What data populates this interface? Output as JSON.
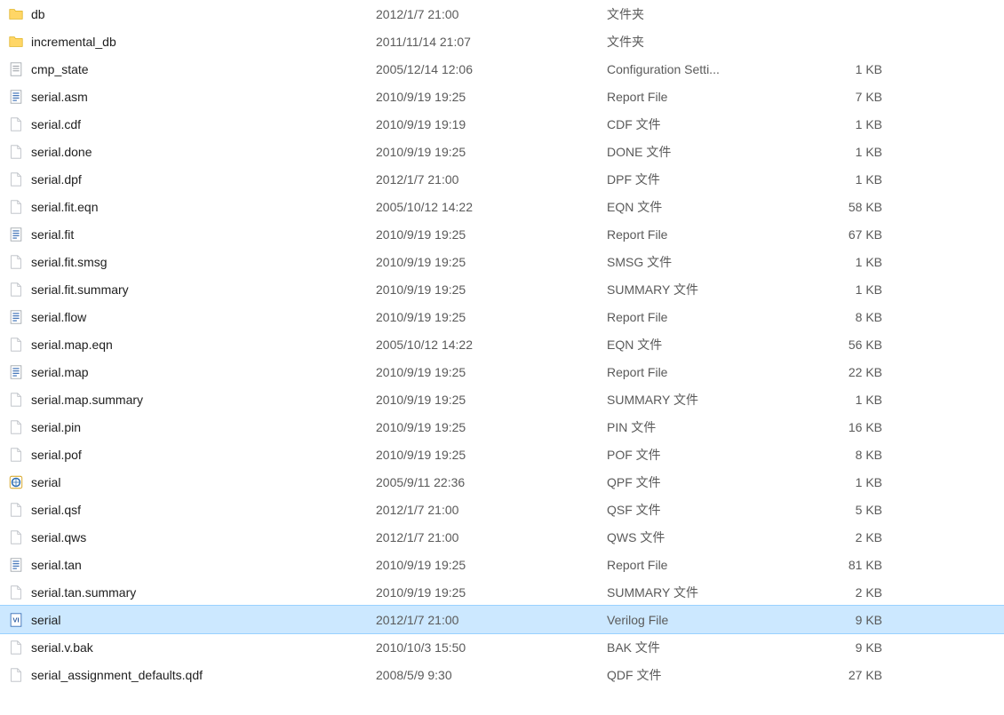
{
  "files": [
    {
      "icon": "folder",
      "name": "db",
      "date": "2012/1/7 21:00",
      "type": "文件夹",
      "size": "",
      "selected": false
    },
    {
      "icon": "folder",
      "name": "incremental_db",
      "date": "2011/11/14 21:07",
      "type": "文件夹",
      "size": "",
      "selected": false
    },
    {
      "icon": "text-lines",
      "name": "cmp_state",
      "date": "2005/12/14 12:06",
      "type": "Configuration Setti...",
      "size": "1 KB",
      "selected": false
    },
    {
      "icon": "report",
      "name": "serial.asm",
      "date": "2010/9/19 19:25",
      "type": "Report File",
      "size": "7 KB",
      "selected": false
    },
    {
      "icon": "blank",
      "name": "serial.cdf",
      "date": "2010/9/19 19:19",
      "type": "CDF 文件",
      "size": "1 KB",
      "selected": false
    },
    {
      "icon": "blank",
      "name": "serial.done",
      "date": "2010/9/19 19:25",
      "type": "DONE 文件",
      "size": "1 KB",
      "selected": false
    },
    {
      "icon": "blank",
      "name": "serial.dpf",
      "date": "2012/1/7 21:00",
      "type": "DPF 文件",
      "size": "1 KB",
      "selected": false
    },
    {
      "icon": "blank",
      "name": "serial.fit.eqn",
      "date": "2005/10/12 14:22",
      "type": "EQN 文件",
      "size": "58 KB",
      "selected": false
    },
    {
      "icon": "report",
      "name": "serial.fit",
      "date": "2010/9/19 19:25",
      "type": "Report File",
      "size": "67 KB",
      "selected": false
    },
    {
      "icon": "blank",
      "name": "serial.fit.smsg",
      "date": "2010/9/19 19:25",
      "type": "SMSG 文件",
      "size": "1 KB",
      "selected": false
    },
    {
      "icon": "blank",
      "name": "serial.fit.summary",
      "date": "2010/9/19 19:25",
      "type": "SUMMARY 文件",
      "size": "1 KB",
      "selected": false
    },
    {
      "icon": "report",
      "name": "serial.flow",
      "date": "2010/9/19 19:25",
      "type": "Report File",
      "size": "8 KB",
      "selected": false
    },
    {
      "icon": "blank",
      "name": "serial.map.eqn",
      "date": "2005/10/12 14:22",
      "type": "EQN 文件",
      "size": "56 KB",
      "selected": false
    },
    {
      "icon": "report",
      "name": "serial.map",
      "date": "2010/9/19 19:25",
      "type": "Report File",
      "size": "22 KB",
      "selected": false
    },
    {
      "icon": "blank",
      "name": "serial.map.summary",
      "date": "2010/9/19 19:25",
      "type": "SUMMARY 文件",
      "size": "1 KB",
      "selected": false
    },
    {
      "icon": "blank",
      "name": "serial.pin",
      "date": "2010/9/19 19:25",
      "type": "PIN 文件",
      "size": "16 KB",
      "selected": false
    },
    {
      "icon": "blank",
      "name": "serial.pof",
      "date": "2010/9/19 19:25",
      "type": "POF 文件",
      "size": "8 KB",
      "selected": false
    },
    {
      "icon": "qpf",
      "name": "serial",
      "date": "2005/9/11 22:36",
      "type": "QPF 文件",
      "size": "1 KB",
      "selected": false
    },
    {
      "icon": "blank",
      "name": "serial.qsf",
      "date": "2012/1/7 21:00",
      "type": "QSF 文件",
      "size": "5 KB",
      "selected": false
    },
    {
      "icon": "blank",
      "name": "serial.qws",
      "date": "2012/1/7 21:00",
      "type": "QWS 文件",
      "size": "2 KB",
      "selected": false
    },
    {
      "icon": "report",
      "name": "serial.tan",
      "date": "2010/9/19 19:25",
      "type": "Report File",
      "size": "81 KB",
      "selected": false
    },
    {
      "icon": "blank",
      "name": "serial.tan.summary",
      "date": "2010/9/19 19:25",
      "type": "SUMMARY 文件",
      "size": "2 KB",
      "selected": false
    },
    {
      "icon": "verilog",
      "name": "serial",
      "date": "2012/1/7 21:00",
      "type": "Verilog File",
      "size": "9 KB",
      "selected": true
    },
    {
      "icon": "blank",
      "name": "serial.v.bak",
      "date": "2010/10/3 15:50",
      "type": "BAK 文件",
      "size": "9 KB",
      "selected": false
    },
    {
      "icon": "blank",
      "name": "serial_assignment_defaults.qdf",
      "date": "2008/5/9 9:30",
      "type": "QDF 文件",
      "size": "27 KB",
      "selected": false
    }
  ]
}
